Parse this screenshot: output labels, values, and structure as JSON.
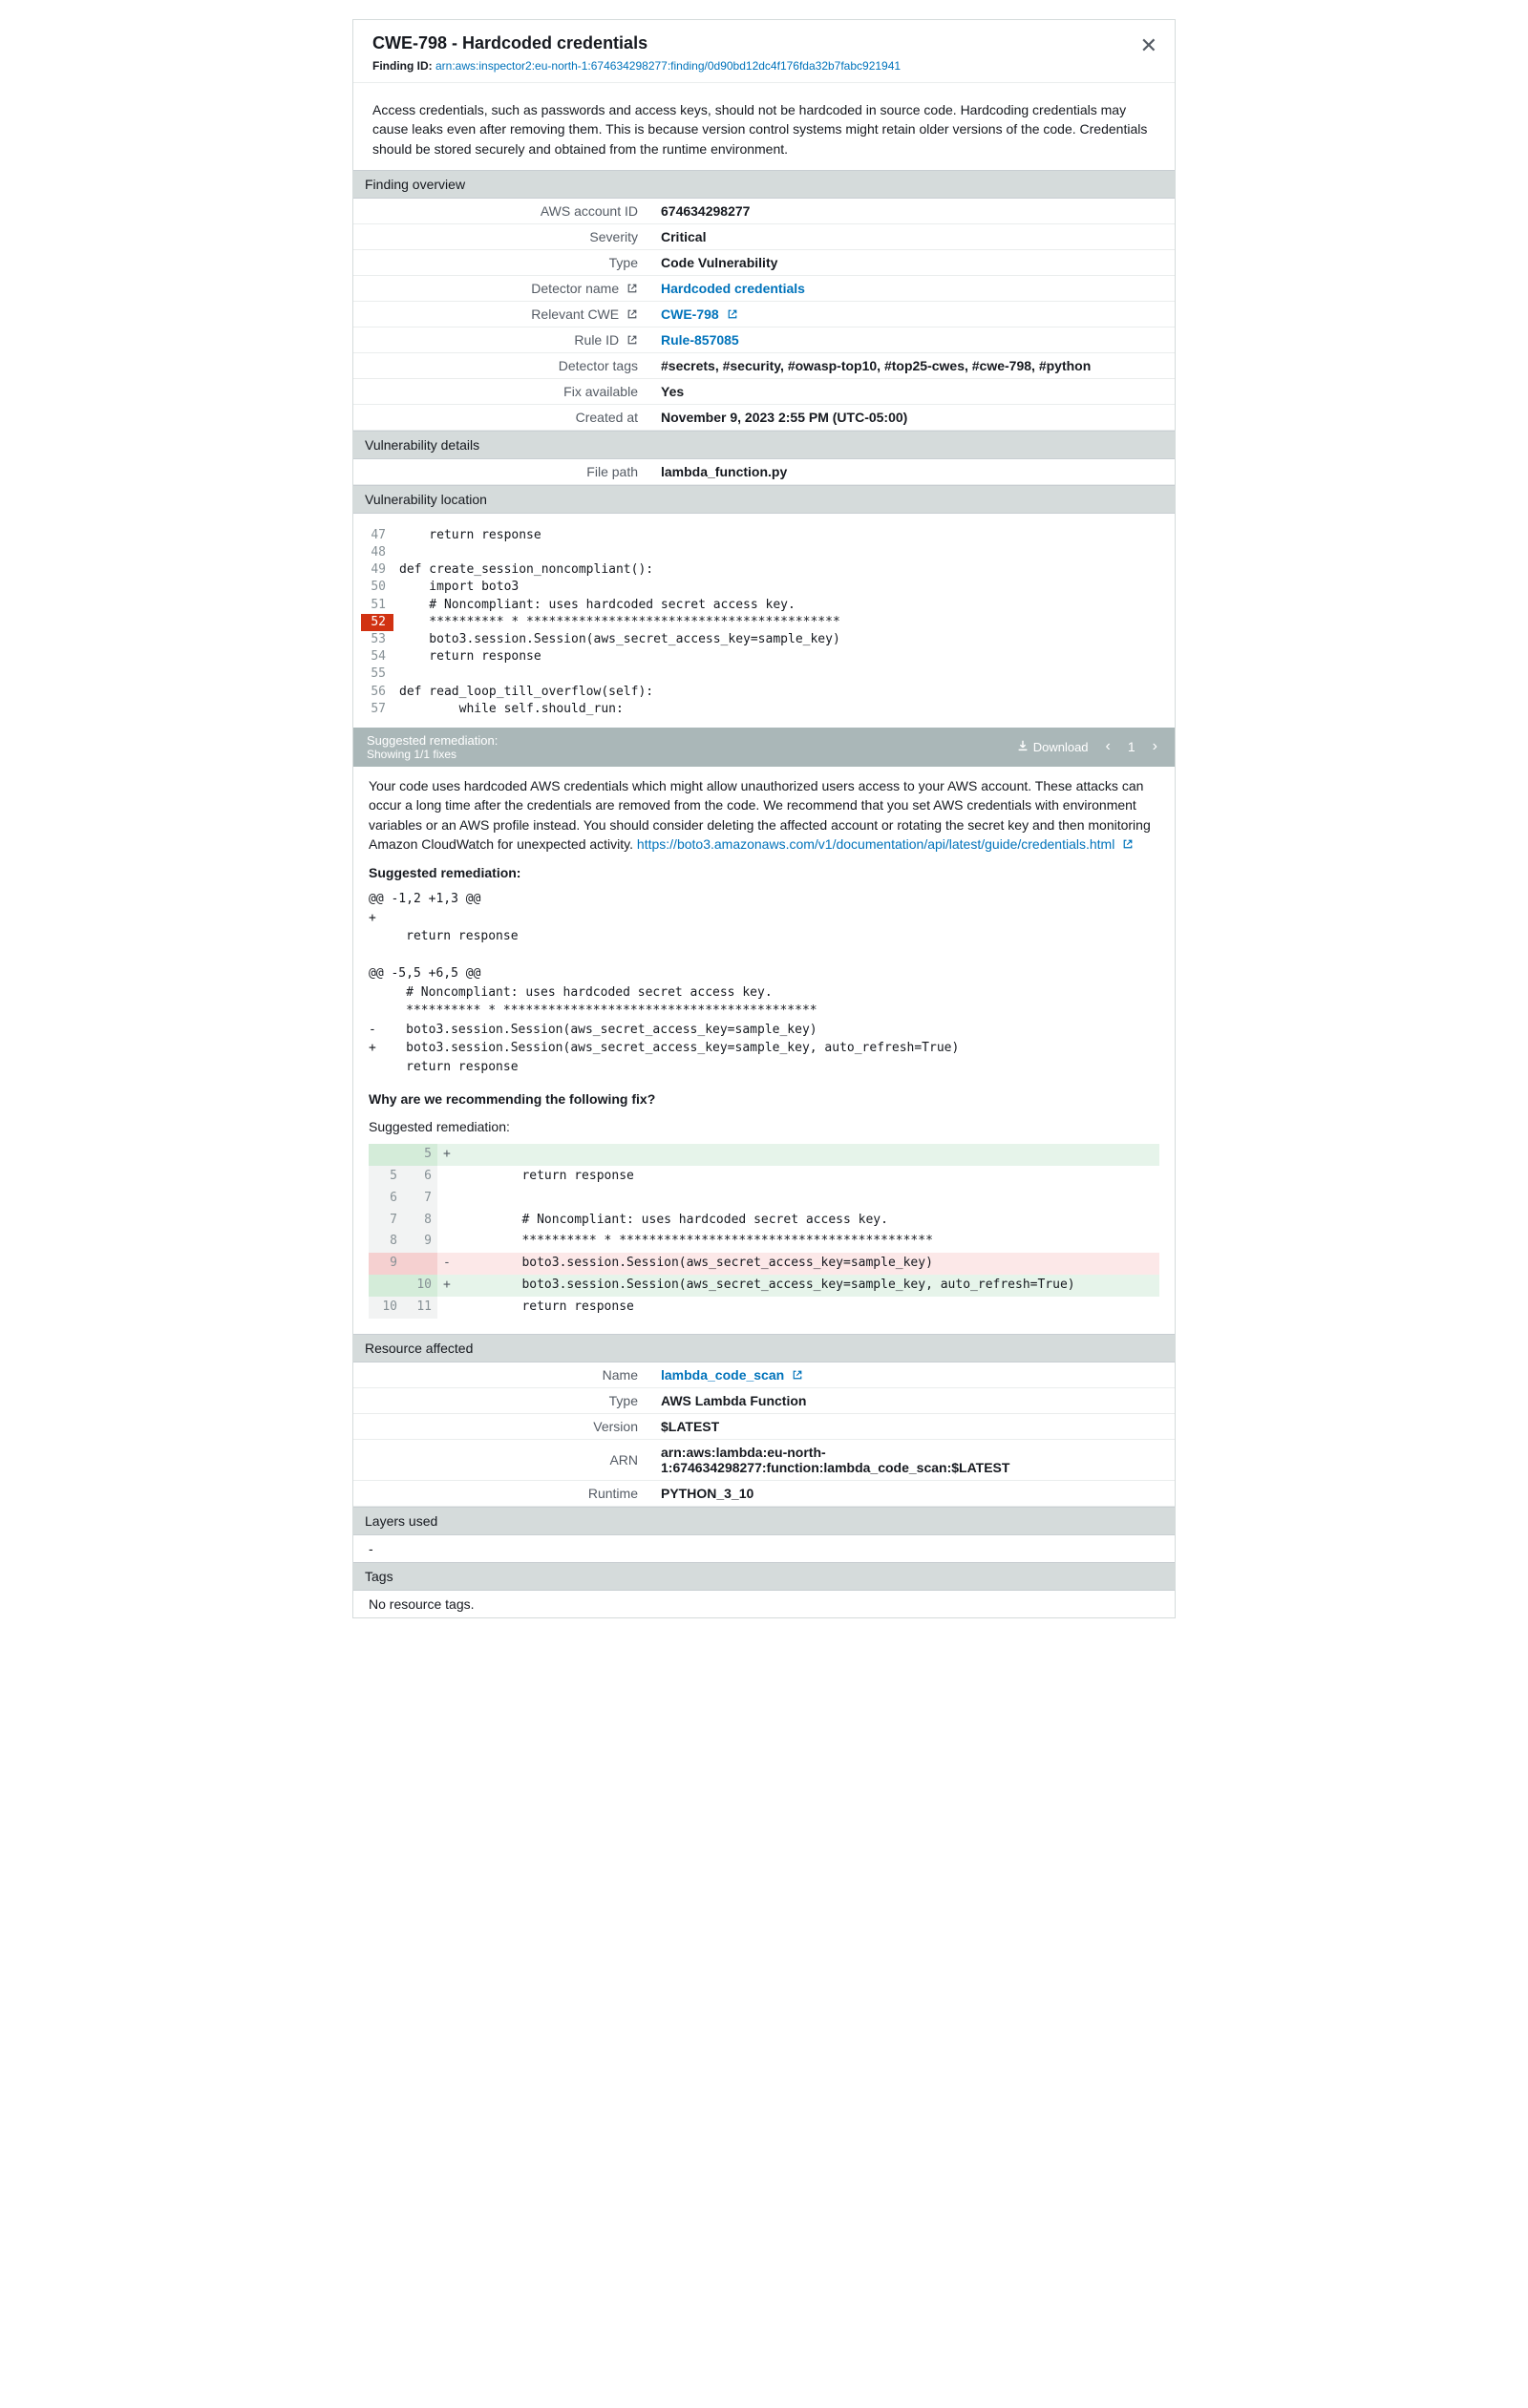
{
  "header": {
    "title": "CWE-798 - Hardcoded credentials",
    "finding_id_label": "Finding ID:",
    "finding_id": "arn:aws:inspector2:eu-north-1:674634298277:finding/0d90bd12dc4f176fda32b7fabc921941"
  },
  "description": "Access credentials, such as passwords and access keys, should not be hardcoded in source code. Hardcoding credentials may cause leaks even after removing them. This is because version control systems might retain older versions of the code. Credentials should be stored securely and obtained from the runtime environment.",
  "sections": {
    "overview": "Finding overview",
    "vuln_details": "Vulnerability details",
    "vuln_location": "Vulnerability location",
    "resource": "Resource affected",
    "layers": "Layers used",
    "tags": "Tags"
  },
  "overview": {
    "rows": [
      {
        "k": "AWS account ID",
        "v": "674634298277"
      },
      {
        "k": "Severity",
        "v": "Critical"
      },
      {
        "k": "Type",
        "v": "Code Vulnerability"
      },
      {
        "k": "Detector name",
        "k_icon": true,
        "v": "Hardcoded credentials",
        "v_link": true
      },
      {
        "k": "Relevant CWE",
        "k_icon": true,
        "v": "CWE-798",
        "v_link": true,
        "v_icon": true
      },
      {
        "k": "Rule ID",
        "k_icon": true,
        "v": "Rule-857085",
        "v_link": true
      },
      {
        "k": "Detector tags",
        "v": "#secrets, #security, #owasp-top10, #top25-cwes, #cwe-798, #python"
      },
      {
        "k": "Fix available",
        "v": "Yes"
      },
      {
        "k": "Created at",
        "v": "November 9, 2023 2:55 PM (UTC-05:00)"
      }
    ]
  },
  "vuln_details": {
    "rows": [
      {
        "k": "File path",
        "v": "lambda_function.py"
      }
    ]
  },
  "code": [
    {
      "n": "47",
      "t": "    return response"
    },
    {
      "n": "48",
      "t": ""
    },
    {
      "n": "49",
      "t": "def create_session_noncompliant():"
    },
    {
      "n": "50",
      "t": "    import boto3"
    },
    {
      "n": "51",
      "t": "    # Noncompliant: uses hardcoded secret access key."
    },
    {
      "n": "52",
      "t": "    ********** * ******************************************",
      "hl": true
    },
    {
      "n": "53",
      "t": "    boto3.session.Session(aws_secret_access_key=sample_key)"
    },
    {
      "n": "54",
      "t": "    return response"
    },
    {
      "n": "55",
      "t": ""
    },
    {
      "n": "56",
      "t": "def read_loop_till_overflow(self):"
    },
    {
      "n": "57",
      "t": "        while self.should_run:"
    }
  ],
  "remediation_bar": {
    "title": "Suggested remediation:",
    "subtitle": "Showing 1/1 fixes",
    "download": "Download",
    "page": "1"
  },
  "remediation": {
    "intro_pre": "Your code uses hardcoded AWS credentials which might allow unauthorized users access to your AWS account. These attacks can occur a long time after the credentials are removed from the code. We recommend that you set AWS credentials with environment variables or an AWS profile instead. You should consider deleting the affected account or rotating the secret key and then monitoring Amazon CloudWatch for unexpected activity. ",
    "intro_link": "https://boto3.amazonaws.com/v1/documentation/api/latest/guide/credentials.html",
    "suggested_label": "Suggested remediation:",
    "diff_text": "@@ -1,2 +1,3 @@\n+\n     return response\n\n@@ -5,5 +6,5 @@\n     # Noncompliant: uses hardcoded secret access key.\n     ********** * ******************************************\n-    boto3.session.Session(aws_secret_access_key=sample_key)\n+    boto3.session.Session(aws_secret_access_key=sample_key, auto_refresh=True)\n     return response\n",
    "why_heading": "Why are we recommending the following fix?",
    "diff_rows": [
      {
        "a": "",
        "b": "5",
        "sign": "+",
        "code": "",
        "cls": "add"
      },
      {
        "a": "5",
        "b": "6",
        "sign": "",
        "code": "        return response"
      },
      {
        "a": "6",
        "b": "7",
        "sign": "",
        "code": ""
      },
      {
        "a": "7",
        "b": "8",
        "sign": "",
        "code": "        # Noncompliant: uses hardcoded secret access key."
      },
      {
        "a": "8",
        "b": "9",
        "sign": "",
        "code": "        ********** * ******************************************"
      },
      {
        "a": "9",
        "b": "",
        "sign": "-",
        "code": "        boto3.session.Session(aws_secret_access_key=sample_key)",
        "cls": "del"
      },
      {
        "a": "",
        "b": "10",
        "sign": "+",
        "code": "        boto3.session.Session(aws_secret_access_key=sample_key, auto_refresh=True)",
        "cls": "add"
      },
      {
        "a": "10",
        "b": "11",
        "sign": "",
        "code": "        return response"
      }
    ]
  },
  "resource": {
    "rows": [
      {
        "k": "Name",
        "v": "lambda_code_scan",
        "v_link": true,
        "v_icon": true
      },
      {
        "k": "Type",
        "v": "AWS Lambda Function"
      },
      {
        "k": "Version",
        "v": "$LATEST"
      },
      {
        "k": "ARN",
        "v": "arn:aws:lambda:eu-north-1:674634298277:function:lambda_code_scan:$LATEST"
      },
      {
        "k": "Runtime",
        "v": "PYTHON_3_10"
      }
    ]
  },
  "layers_body": "-",
  "tags_body": "No resource tags."
}
